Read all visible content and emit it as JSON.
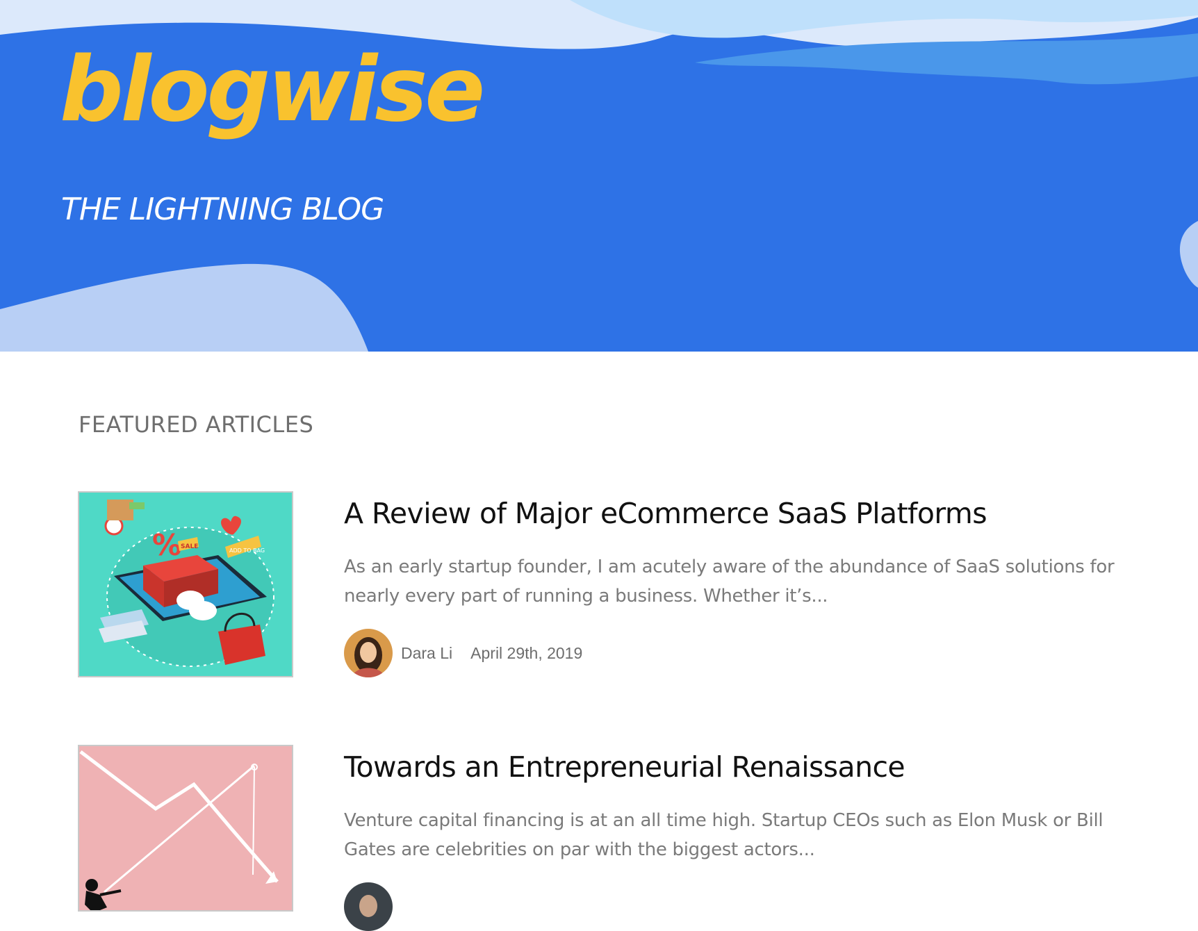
{
  "header": {
    "logo_text": "blogwise",
    "tagline": "THE LIGHTNING BLOG",
    "background_color": "#2e72e6",
    "logo_color": "#f9c22e"
  },
  "featured": {
    "section_title": "FEATURED ARTICLES",
    "articles": [
      {
        "title": "A Review of Major eCommerce SaaS Platforms",
        "excerpt": "As an early startup founder, I am acutely aware of the abundance of SaaS solutions for nearly every part of running a business. Whether it’s...",
        "author": "Dara Li",
        "date": "April 29th, 2019",
        "thumbnail": "ecommerce-illustration"
      },
      {
        "title": "Towards an Entrepreneurial Renaissance",
        "excerpt": "Venture capital financing is at an all time high. Startup CEOs such as Elon Musk or Bill Gates are celebrities on par with the biggest actors...",
        "thumbnail": "declining-chart-illustration"
      }
    ]
  }
}
